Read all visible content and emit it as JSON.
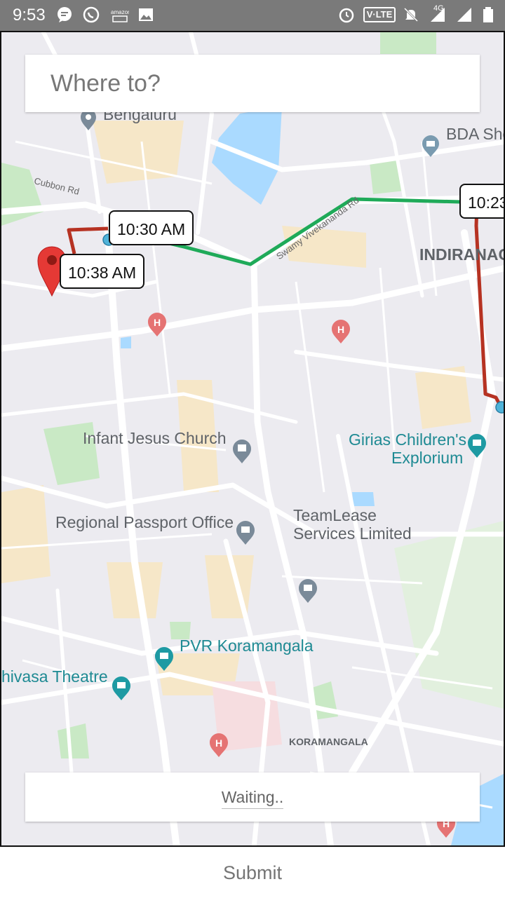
{
  "status_bar": {
    "time": "9:53",
    "volte": "V·LTE",
    "network": "4G",
    "icons": [
      "message-icon",
      "whatsapp-icon",
      "amazon-icon",
      "gallery-icon",
      "alarm-icon",
      "volte-icon",
      "mute-icon",
      "signal-4g-icon",
      "signal-icon",
      "battery-icon"
    ]
  },
  "search": {
    "placeholder": "Where to?"
  },
  "map": {
    "colors": {
      "land": "#ecebf0",
      "water": "#aadaff",
      "park": "#c9e9c5",
      "road": "#ffffff",
      "route_red": "#b63222",
      "route_green": "#1faa59"
    },
    "time_labels": [
      "10:30 AM",
      "10:38 AM",
      "10:23"
    ],
    "places": [
      {
        "name": "Bengaluru",
        "icon": "place-icon",
        "color": "gray"
      },
      {
        "name": "BDA Sho",
        "icon": "government-icon",
        "color": "gray"
      },
      {
        "name": "Infant Jesus Church",
        "icon": "church-icon",
        "color": "gray"
      },
      {
        "name": "Girias Children's",
        "line2": "Explorium",
        "icon": "museum-icon",
        "color": "teal"
      },
      {
        "name": "Regional Passport Office",
        "icon": "government-icon",
        "color": "gray"
      },
      {
        "name": "TeamLease",
        "line2": "Services Limited",
        "icon": "",
        "color": "gray"
      },
      {
        "name": "PVR Koramangala",
        "icon": "cinema-icon",
        "color": "teal"
      },
      {
        "name": "hivasa Theatre",
        "icon": "cinema-icon",
        "color": "teal"
      }
    ],
    "areas": [
      "INDIRANAG",
      "KORAMANGALA"
    ],
    "roads": [
      "Cubbon Rd",
      "Swamy Vivekananda Rd"
    ]
  },
  "waiting": {
    "text": "Waiting.."
  },
  "submit": {
    "label": "Submit"
  }
}
